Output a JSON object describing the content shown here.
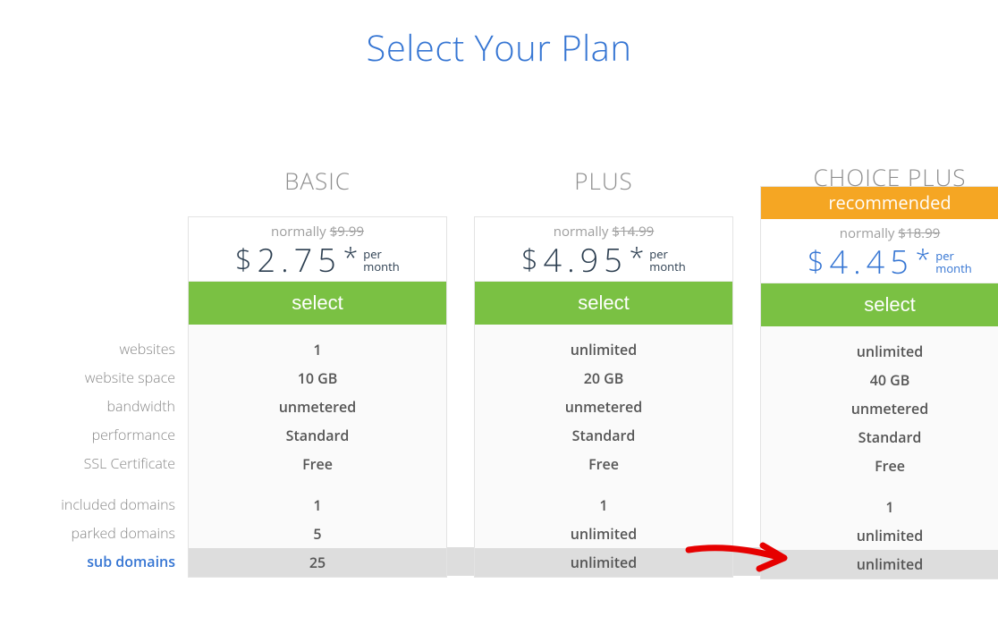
{
  "title": "Select Your Plan",
  "labels": {
    "normally": "normally",
    "per": "per",
    "month": "month",
    "select": "select",
    "recommended": "recommended"
  },
  "features_group1": [
    "websites",
    "website space",
    "bandwidth",
    "performance",
    "SSL Certificate"
  ],
  "features_group2": [
    "included domains",
    "parked domains",
    "sub domains"
  ],
  "plans": [
    {
      "name": "BASIC",
      "recommended": false,
      "normal_price": "$9.99",
      "price": "2.75",
      "promo_color": false,
      "g1": [
        "1",
        "10 GB",
        "unmetered",
        "Standard",
        "Free"
      ],
      "g2": [
        "1",
        "5",
        "25"
      ]
    },
    {
      "name": "PLUS",
      "recommended": false,
      "normal_price": "$14.99",
      "price": "4.95",
      "promo_color": false,
      "g1": [
        "unlimited",
        "20 GB",
        "unmetered",
        "Standard",
        "Free"
      ],
      "g2": [
        "1",
        "unlimited",
        "unlimited"
      ]
    },
    {
      "name": "CHOICE PLUS",
      "recommended": true,
      "normal_price": "$18.99",
      "price": "4.45",
      "promo_color": true,
      "g1": [
        "unlimited",
        "40 GB",
        "unmetered",
        "Standard",
        "Free"
      ],
      "g2": [
        "1",
        "unlimited",
        "unlimited"
      ]
    }
  ]
}
